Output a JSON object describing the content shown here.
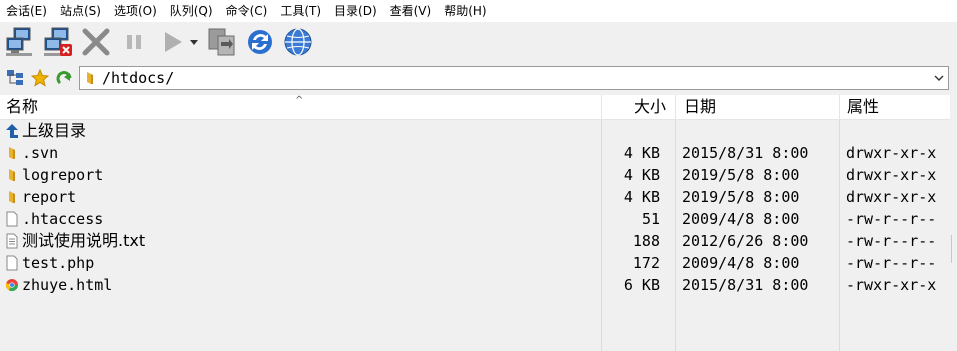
{
  "menu": [
    {
      "label": "会话(E)"
    },
    {
      "label": "站点(S)"
    },
    {
      "label": "选项(O)"
    },
    {
      "label": "队列(Q)"
    },
    {
      "label": "命令(C)"
    },
    {
      "label": "工具(T)"
    },
    {
      "label": "目录(D)"
    },
    {
      "label": "查看(V)"
    },
    {
      "label": "帮助(H)"
    }
  ],
  "toolbar": {
    "icons": [
      "connect-icon",
      "disconnect-icon",
      "cancel-icon",
      "pause-icon",
      "play-icon",
      "dropdown-icon",
      "sync-icon",
      "refresh-icon",
      "browser-icon"
    ]
  },
  "address": {
    "path": "/htdocs/"
  },
  "columns": {
    "name": "名称",
    "size": "大小",
    "date": "日期",
    "attr": "属性"
  },
  "parent": {
    "label": "上级目录"
  },
  "files": [
    {
      "name": ".svn",
      "size": "4 KB",
      "date": "2015/8/31 8:00",
      "attr": "drwxr-xr-x",
      "icon": "folder-icon"
    },
    {
      "name": "logreport",
      "size": "4 KB",
      "date": "2019/5/8 8:00",
      "attr": "drwxr-xr-x",
      "icon": "folder-icon"
    },
    {
      "name": "report",
      "size": "4 KB",
      "date": "2019/5/8 8:00",
      "attr": "drwxr-xr-x",
      "icon": "folder-icon"
    },
    {
      "name": ".htaccess",
      "size": "51",
      "date": "2009/4/8 8:00",
      "attr": "-rw-r--r--",
      "icon": "file-icon"
    },
    {
      "name": "测试使用说明.txt",
      "size": "188",
      "date": "2012/6/26 8:00",
      "attr": "-rw-r--r--",
      "icon": "text-file-icon"
    },
    {
      "name": "test.php",
      "size": "172",
      "date": "2009/4/8 8:00",
      "attr": "-rw-r--r--",
      "icon": "file-icon"
    },
    {
      "name": "zhuye.html",
      "size": "6 KB",
      "date": "2015/8/31 8:00",
      "attr": "-rwxr-xr-x",
      "icon": "html-file-icon"
    }
  ]
}
